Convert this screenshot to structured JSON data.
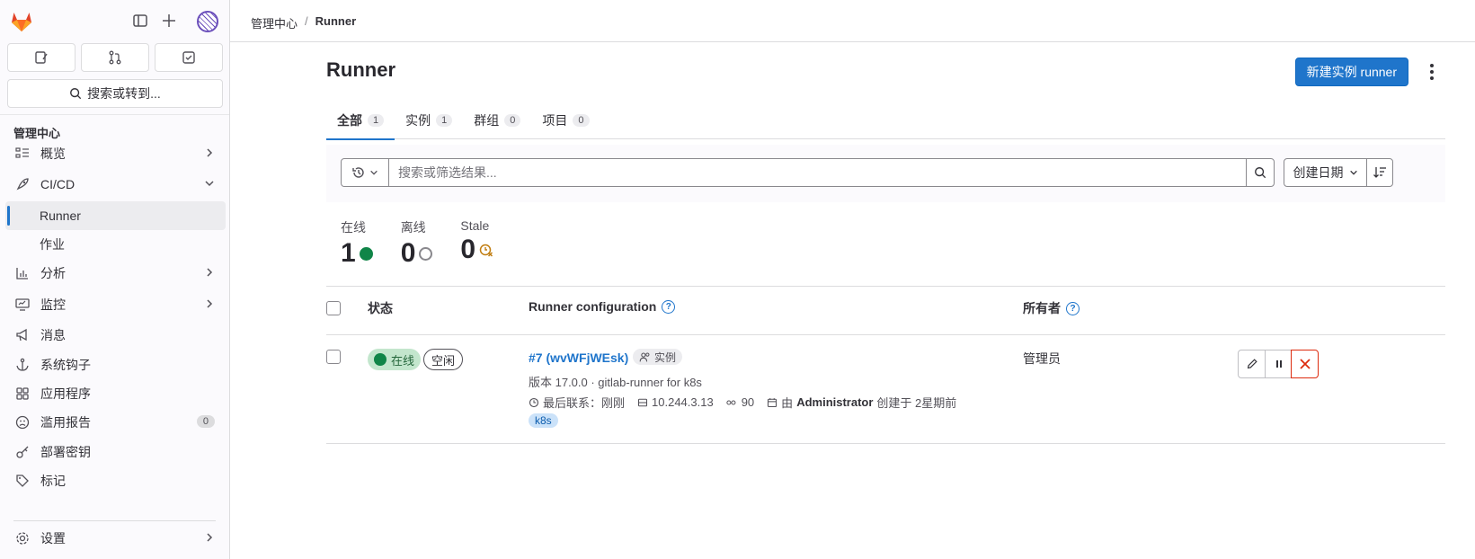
{
  "sidebar": {
    "search_label": "搜索或转到...",
    "section_title": "管理中心",
    "items": [
      {
        "label": "概览"
      },
      {
        "label": "CI/CD"
      },
      {
        "label": "Runner"
      },
      {
        "label": "作业"
      },
      {
        "label": "分析"
      },
      {
        "label": "监控"
      },
      {
        "label": "消息"
      },
      {
        "label": "系统钩子"
      },
      {
        "label": "应用程序"
      },
      {
        "label": "滥用报告",
        "badge": "0"
      },
      {
        "label": "部署密钥"
      },
      {
        "label": "标记"
      },
      {
        "label": "设置"
      }
    ]
  },
  "breadcrumb": {
    "parent": "管理中心",
    "current": "Runner"
  },
  "page": {
    "title": "Runner",
    "new_button": "新建实例 runner"
  },
  "tabs": [
    {
      "label": "全部",
      "count": "1"
    },
    {
      "label": "实例",
      "count": "1"
    },
    {
      "label": "群组",
      "count": "0"
    },
    {
      "label": "项目",
      "count": "0"
    }
  ],
  "filter": {
    "search_placeholder": "搜索或筛选结果...",
    "sort_label": "创建日期"
  },
  "stats": {
    "online_label": "在线",
    "online_value": "1",
    "offline_label": "离线",
    "offline_value": "0",
    "stale_label": "Stale",
    "stale_value": "0"
  },
  "table": {
    "headers": {
      "status": "状态",
      "config": "Runner configuration",
      "owner": "所有者"
    },
    "rows": [
      {
        "status": "在线",
        "state": "空闲",
        "name": "#7 (wvWFjWEsk)",
        "type": "实例",
        "version": "版本 17.0.0 · gitlab-runner for k8s",
        "last_contact": "最后联系：刚刚",
        "ip": "10.244.3.13",
        "jobs": "90",
        "created_prefix": "由",
        "created_by": "Administrator",
        "created_suffix": "创建于 2星期前",
        "tag": "k8s",
        "owner": "管理员"
      }
    ]
  },
  "colors": {
    "accent": "#1f75cb",
    "online": "#108548",
    "danger": "#dd2b0e",
    "stale": "#c17d10"
  }
}
